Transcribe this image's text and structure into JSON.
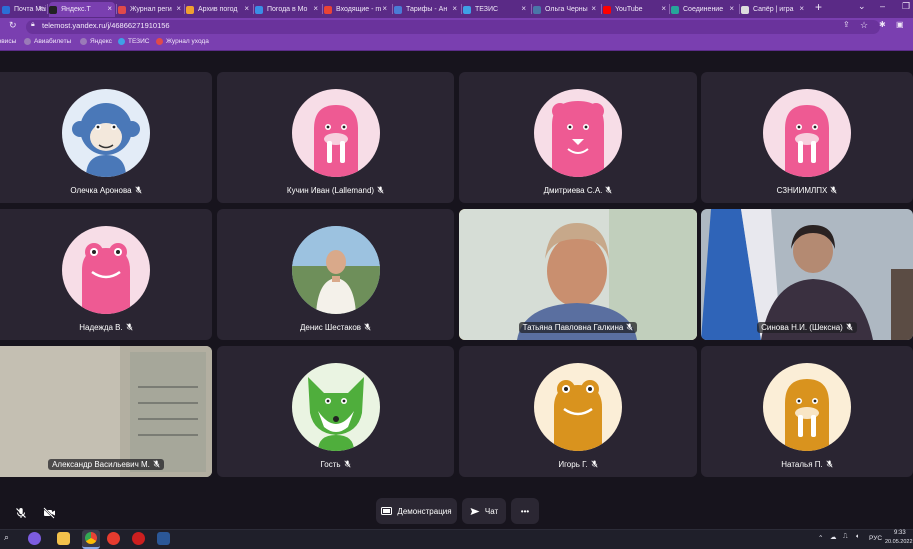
{
  "browser": {
    "tabs": [
      {
        "title": "Почта Mail.ru",
        "favicon_color": "#2b6ed6"
      },
      {
        "title": "Яндекс.Т",
        "favicon_color": "#222222"
      },
      {
        "title": "Журнал реги",
        "favicon_color": "#e04a4a"
      },
      {
        "title": "Архив погод",
        "favicon_color": "#f0a030"
      },
      {
        "title": "Погода в Мо",
        "favicon_color": "#3a8ee6"
      },
      {
        "title": "Входящие - m",
        "favicon_color": "#ea4335"
      },
      {
        "title": "Тарифы - Ан",
        "favicon_color": "#4a7bd6"
      },
      {
        "title": "ТЕЗИС",
        "favicon_color": "#3fa0e6"
      },
      {
        "title": "Ольга Черны",
        "favicon_color": "#4a76a8"
      },
      {
        "title": "YouTube",
        "favicon_color": "#ff0000"
      },
      {
        "title": "Соединение",
        "favicon_color": "#26a69a"
      },
      {
        "title": "Сапёр | игра",
        "favicon_color": "#dddddd"
      }
    ],
    "new_tab": "+",
    "url": "telemost.yandex.ru/j/46866271910156",
    "bookmarks": [
      {
        "label": "ервисы",
        "color": "#c9a6ea"
      },
      {
        "label": "Авиабилеты",
        "color": "#9a7ab8"
      },
      {
        "label": "Яндекс",
        "color": "#9a7ab8"
      },
      {
        "label": "ТЕЗИС",
        "color": "#3fa0e6"
      },
      {
        "label": "Журнал ухода",
        "color": "#e04a4a"
      }
    ]
  },
  "participants": [
    {
      "name": "Олечка Аронова",
      "avatar": "monkey-icon",
      "bg": "#e3ecf7",
      "fg": "#4a78b8",
      "type": "avatar"
    },
    {
      "name": "Кучин Иван (Lallemand)",
      "avatar": "walrus-icon",
      "bg": "#f7dde7",
      "fg": "#ee5a93",
      "type": "avatar"
    },
    {
      "name": "Дмитриева С.А.",
      "avatar": "lion-icon",
      "bg": "#f7dde7",
      "fg": "#ee5a93",
      "type": "avatar"
    },
    {
      "name": "СЗНИИМЛПХ",
      "avatar": "walrus-icon",
      "bg": "#f7dde7",
      "fg": "#ee5a93",
      "type": "avatar"
    },
    {
      "name": "Надежда В.",
      "avatar": "frog-icon",
      "bg": "#f7dde7",
      "fg": "#ee5a93",
      "type": "avatar"
    },
    {
      "name": "Денис Шестаков",
      "avatar": "photo-avatar",
      "bg": "#8fb6d8",
      "fg": "#444444",
      "type": "photo"
    },
    {
      "name": "Татьяна Павловна Галкина",
      "avatar": "video-feed",
      "bg": "#c9d6c6",
      "fg": "#7a6050",
      "type": "video",
      "speaking": true
    },
    {
      "name": "Синова Н.И. (Шексна)",
      "avatar": "video-feed",
      "bg": "#8a99a8",
      "fg": "#3a3030",
      "type": "video"
    },
    {
      "name": "Александр Васильевич М.",
      "avatar": "video-feed",
      "bg": "#b7b2a4",
      "fg": "#6a6a60",
      "type": "video"
    },
    {
      "name": "Гость",
      "avatar": "fox-icon",
      "bg": "#eaf4e2",
      "fg": "#4fae3c",
      "type": "avatar"
    },
    {
      "name": "Игорь Г.",
      "avatar": "frog-icon",
      "bg": "#fbeed7",
      "fg": "#d9931e",
      "type": "avatar"
    },
    {
      "name": "Наталья П.",
      "avatar": "walrus-icon",
      "bg": "#fbeed7",
      "fg": "#d9931e",
      "type": "avatar"
    }
  ],
  "controls": {
    "mic": "mic-off-icon",
    "camera": "camera-off-icon",
    "screen_share_label": "Демонстрация",
    "chat_label": "Чат",
    "more": "•••"
  },
  "taskbar": {
    "language": "РУС",
    "time": "9:33",
    "date": "20.05.2022"
  }
}
